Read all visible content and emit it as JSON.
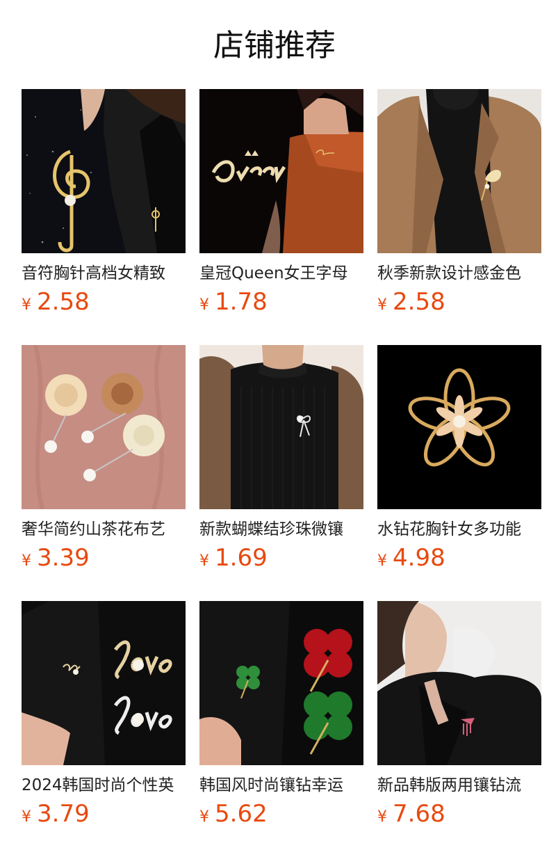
{
  "section": {
    "title": "店铺推荐",
    "accent_color": "#e8490f"
  },
  "products": [
    {
      "name": "音符胸针高档女精致",
      "currency": "¥",
      "price": "2.58",
      "image": "treble-clef-brooch-on-black-blazer"
    },
    {
      "name": "皇冠Queen女王字母",
      "currency": "¥",
      "price": "1.78",
      "image": "queen-letter-brooch-on-orange-top"
    },
    {
      "name": "秋季新款设计感金色",
      "currency": "¥",
      "price": "2.58",
      "image": "ginkgo-leaf-brooch-on-camel-blazer"
    },
    {
      "name": "奢华简约山茶花布艺",
      "currency": "¥",
      "price": "3.39",
      "image": "fabric-rose-pearl-pins-on-pink"
    },
    {
      "name": "新款蝴蝶结珍珠微镶",
      "currency": "¥",
      "price": "1.69",
      "image": "pearl-bow-brooch-on-black-sweater"
    },
    {
      "name": "水钻花胸针女多功能",
      "currency": "¥",
      "price": "4.98",
      "image": "gold-flower-rhinestone-brooch"
    },
    {
      "name": "2024韩国时尚个性英",
      "currency": "¥",
      "price": "3.79",
      "image": "love-letter-pearl-brooch"
    },
    {
      "name": "韩国风时尚镶钻幸运",
      "currency": "¥",
      "price": "5.62",
      "image": "four-leaf-clover-rhinestone-brooch"
    },
    {
      "name": "新品韩版两用镶钻流",
      "currency": "¥",
      "price": "7.68",
      "image": "pink-tassel-brooch-on-black-blazer"
    }
  ]
}
